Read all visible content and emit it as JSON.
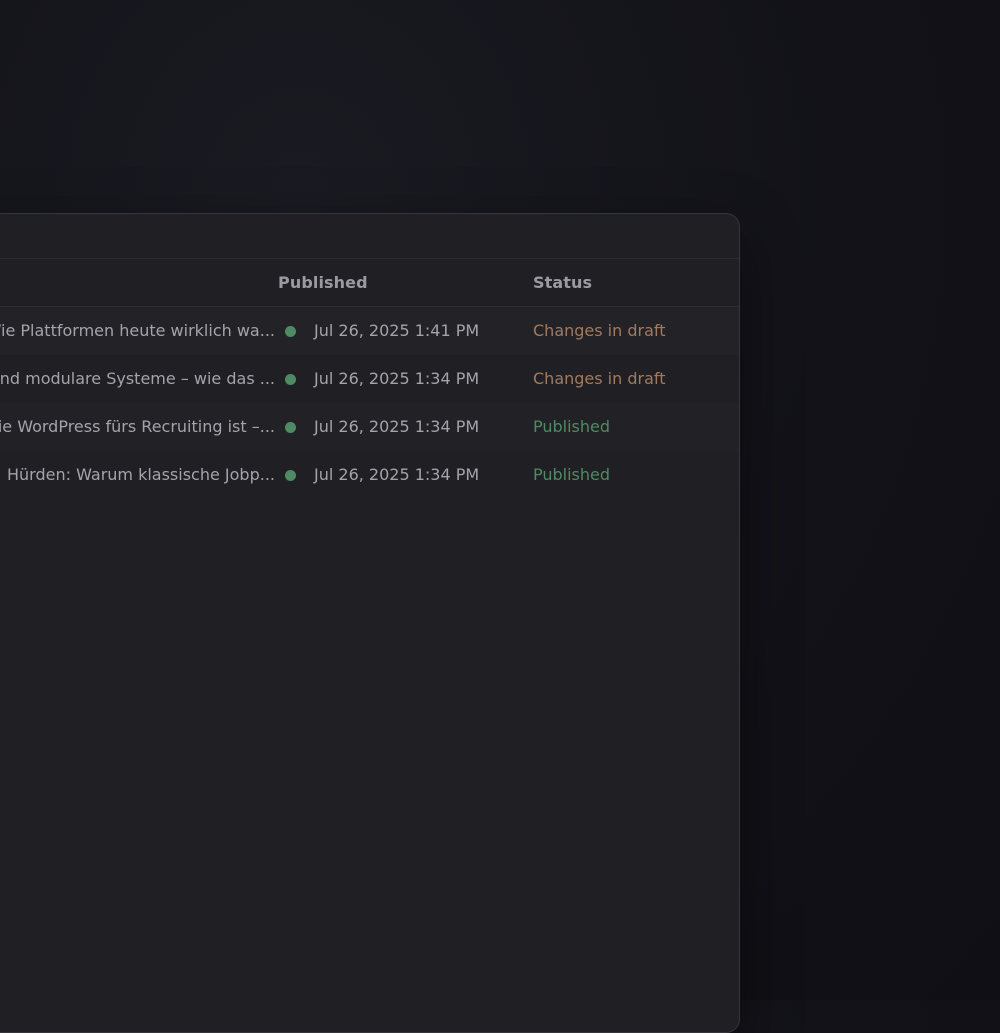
{
  "table": {
    "columns": {
      "published": "Published",
      "status": "Status"
    },
    "rows": [
      {
        "title": "Wie Plattformen heute wirklich wa...",
        "published": "Jul 26, 2025 1:41 PM",
        "status": "Changes in draft",
        "status_type": "draft"
      },
      {
        "title": "und modulare Systeme – wie das ...",
        "published": "Jul 26, 2025 1:34 PM",
        "status": "Changes in draft",
        "status_type": "draft"
      },
      {
        "title": "ie WordPress fürs Recruiting ist –...",
        "published": "Jul 26, 2025 1:34 PM",
        "status": "Published",
        "status_type": "published"
      },
      {
        "title": "Hürden: Warum klassische Jobp...",
        "published": "Jul 26, 2025 1:34 PM",
        "status": "Published",
        "status_type": "published"
      }
    ]
  },
  "colors": {
    "published_dot": "#4f8a64",
    "status_draft": "#a27a5e",
    "status_published": "#4f8a64"
  },
  "icons": {
    "row_indicator": "status-dot-icon"
  }
}
